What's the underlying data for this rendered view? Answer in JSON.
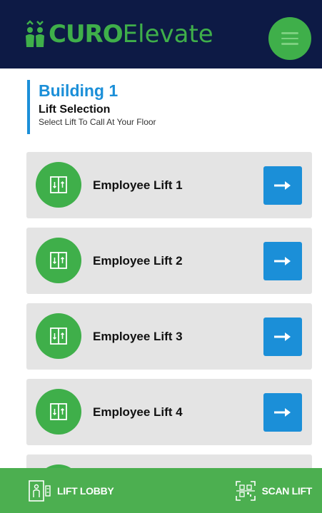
{
  "header": {
    "logo_bold": "CURO",
    "logo_light": "Elevate"
  },
  "page": {
    "building_title": "Building 1",
    "section_title": "Lift Selection",
    "hint": "Select Lift To Call At Your Floor"
  },
  "lifts": [
    {
      "label": "Employee Lift 1"
    },
    {
      "label": "Employee Lift 2"
    },
    {
      "label": "Employee Lift 3"
    },
    {
      "label": "Employee Lift 4"
    }
  ],
  "bottom_nav": {
    "lobby_label": "LIFT LOBBY",
    "scan_label": "SCAN LIFT"
  },
  "colors": {
    "header_bg": "#0d1a45",
    "brand_green": "#3faf4a",
    "accent_blue": "#1b8fd8",
    "card_bg": "#e4e4e4",
    "bottom_bar": "#4caf50"
  },
  "icons": {
    "menu": "hamburger-icon",
    "lift": "elevator-icon",
    "go": "arrow-right-icon",
    "lobby": "lift-lobby-icon",
    "scan": "qr-scan-icon"
  }
}
